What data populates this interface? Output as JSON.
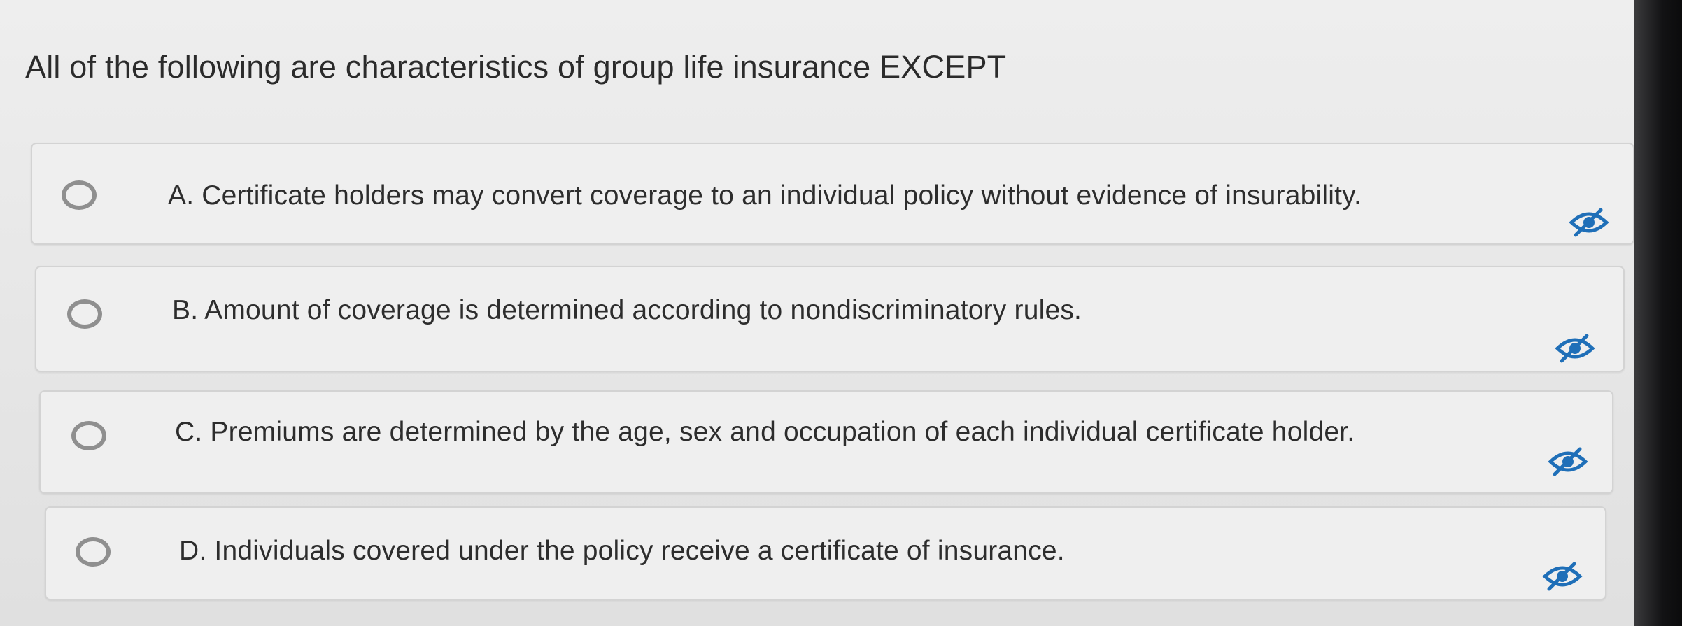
{
  "question": {
    "text": "All of the following are characteristics of group life insurance EXCEPT"
  },
  "options": [
    {
      "letter": "A",
      "text": "A. Certificate holders may convert coverage to an individual policy without evidence of insurability.",
      "selected": false,
      "hide_icon": "eliminate-answer-icon"
    },
    {
      "letter": "B",
      "text": "B. Amount of coverage is determined according to nondiscriminatory rules.",
      "selected": false,
      "hide_icon": "eliminate-answer-icon"
    },
    {
      "letter": "C",
      "text": "C. Premiums are determined by the age, sex and occupation of each individual certificate holder.",
      "selected": false,
      "hide_icon": "eliminate-answer-icon"
    },
    {
      "letter": "D",
      "text": "D. Individuals covered under the policy receive a certificate of insurance.",
      "selected": false,
      "hide_icon": "eliminate-answer-icon"
    }
  ],
  "colors": {
    "icon_blue": "#1f6fb8",
    "radio_border": "#8f8f8f",
    "text": "#2d2d2d"
  }
}
